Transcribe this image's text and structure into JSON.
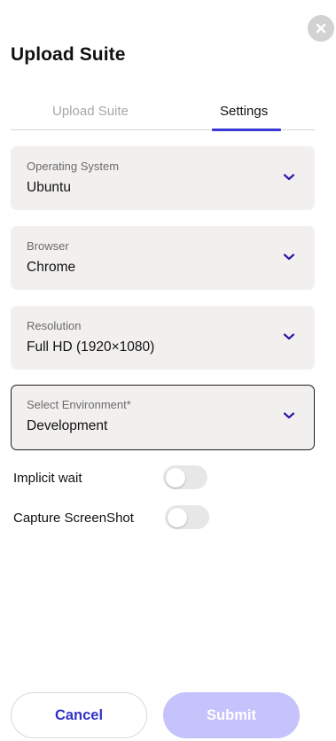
{
  "header": {
    "title": "Upload Suite"
  },
  "tabs": [
    {
      "label": "Upload Suite",
      "active": false
    },
    {
      "label": "Settings",
      "active": true
    }
  ],
  "fields": {
    "os": {
      "label": "Operating System",
      "value": "Ubuntu"
    },
    "browser": {
      "label": "Browser",
      "value": "Chrome"
    },
    "resolution": {
      "label": "Resolution",
      "value": "Full HD (1920×1080)"
    },
    "environment": {
      "label": "Select Environment*",
      "value": "Development"
    }
  },
  "toggles": {
    "implicit_wait": {
      "label": "Implicit wait",
      "on": false
    },
    "capture_screenshot": {
      "label": "Capture ScreenShot",
      "on": false
    }
  },
  "actions": {
    "cancel_label": "Cancel",
    "submit_label": "Submit"
  },
  "colors": {
    "accent": "#3838d6",
    "chevron": "#2a1aa8",
    "submit_disabled": "#c6c2fb",
    "field_bg": "#f2f0ef"
  },
  "icons": {
    "close": "close-icon",
    "dropdown": "chevron-down-icon"
  }
}
